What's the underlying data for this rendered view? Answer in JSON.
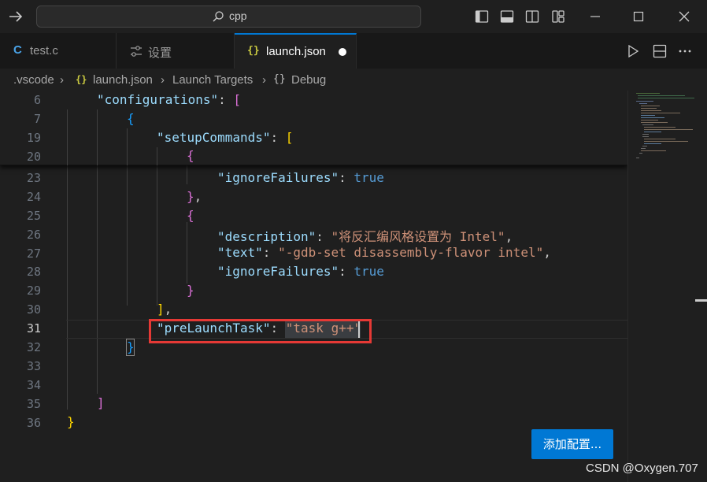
{
  "titlebar": {
    "search_text": "cpp",
    "layout_icons": [
      "toggle-primary-sidebar-icon",
      "toggle-panel-icon",
      "toggle-secondary-sidebar-icon",
      "customize-layout-icon"
    ],
    "window_controls": [
      "minimize-icon",
      "maximize-icon",
      "close-icon"
    ]
  },
  "tabs": [
    {
      "icon": "C",
      "label": "test.c",
      "active": false
    },
    {
      "icon": "settings-icon",
      "label": "设置",
      "active": false
    },
    {
      "icon": "{}",
      "label": "launch.json",
      "active": true,
      "dirty": true
    }
  ],
  "editor_actions": [
    "run-icon",
    "split-editor-icon",
    "more-actions-icon"
  ],
  "breadcrumb": {
    "folder": ".vscode",
    "file_icon": "{}",
    "file": "launch.json",
    "section": "Launch Targets",
    "item_icon": "{}",
    "item": "Debug"
  },
  "sticky_lines": [
    {
      "num": "6",
      "key": "\"configurations\"",
      "colon": ": ",
      "bracket": "["
    },
    {
      "num": "7",
      "bracket": "{"
    },
    {
      "num": "19",
      "key": "\"setupCommands\"",
      "colon": ": ",
      "bracket": "["
    },
    {
      "num": "20",
      "bracket": "{"
    }
  ],
  "code_lines": [
    {
      "num": "23",
      "key": "\"ignoreFailures\"",
      "colon": ": ",
      "val": "true"
    },
    {
      "num": "24",
      "bracket": "}",
      "punct": ","
    },
    {
      "num": "25",
      "bracket": "{"
    },
    {
      "num": "26",
      "key": "\"description\"",
      "colon": ": ",
      "val": "\"将反汇编风格设置为 Intel\"",
      "punct": ","
    },
    {
      "num": "27",
      "key": "\"text\"",
      "colon": ": ",
      "val": "\"-gdb-set disassembly-flavor intel\"",
      "punct": ","
    },
    {
      "num": "28",
      "key": "\"ignoreFailures\"",
      "colon": ": ",
      "val": "true"
    },
    {
      "num": "29",
      "bracket": "}"
    },
    {
      "num": "30",
      "bracket": "]",
      "punct": ","
    },
    {
      "num": "31",
      "key": "\"preLaunchTask\"",
      "colon": ": ",
      "val": "\"task g++\""
    },
    {
      "num": "32",
      "bracket": "}"
    },
    {
      "num": "33"
    },
    {
      "num": "34"
    },
    {
      "num": "35",
      "bracket": "]"
    },
    {
      "num": "36",
      "bracket": "}"
    }
  ],
  "add_config_button": "添加配置...",
  "watermark": "CSDN @Oxygen.707",
  "colors": {
    "accent": "#0078d4",
    "highlight_box": "#e53935",
    "json_key": "#9cdcfe",
    "json_string": "#ce9178",
    "json_bool": "#569cd6"
  }
}
